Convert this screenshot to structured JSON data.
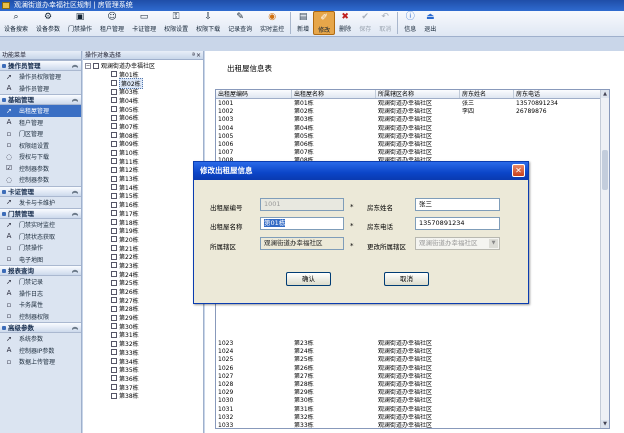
{
  "window": {
    "title": "观澜街道办幸福社区规制 | 房管理系统"
  },
  "toolbar": [
    {
      "label": "设备搜索",
      "icon": "search-device-icon"
    },
    {
      "label": "设备参数",
      "icon": "device-param-icon"
    },
    {
      "label": "门禁操作",
      "icon": "door-control-icon"
    },
    {
      "label": "租户管理",
      "icon": "tenant-icon"
    },
    {
      "label": "卡证管理",
      "icon": "card-icon"
    },
    {
      "label": "权限设置",
      "icon": "permission-icon"
    },
    {
      "label": "权限下载",
      "icon": "download-icon"
    },
    {
      "label": "记录查询",
      "icon": "record-query-icon"
    },
    {
      "label": "实时监控",
      "icon": "monitor-icon"
    },
    {
      "label": "新增",
      "icon": "add-icon"
    },
    {
      "label": "修改",
      "icon": "edit-icon"
    },
    {
      "label": "删除",
      "icon": "delete-icon"
    },
    {
      "label": "保存",
      "icon": "save-icon"
    },
    {
      "label": "取消",
      "icon": "cancel-icon"
    },
    {
      "label": "信息",
      "icon": "info-icon"
    },
    {
      "label": "退出",
      "icon": "exit-icon"
    }
  ],
  "leftpanel": {
    "title": "功能菜单",
    "groups": [
      {
        "title": "操作员管理",
        "items": [
          {
            "label": "操作员权限管理",
            "icon": "cursor"
          },
          {
            "label": "操作员管理",
            "icon": "A"
          }
        ]
      },
      {
        "title": "基础管理",
        "items": [
          {
            "label": "出租屋管理",
            "icon": "cursor"
          },
          {
            "label": "租户管理",
            "icon": "A"
          },
          {
            "label": "门区管理",
            "icon": "square"
          },
          {
            "label": "权限组设置",
            "icon": "square"
          },
          {
            "label": "授权与下载",
            "icon": "circle"
          },
          {
            "label": "控制器参数",
            "icon": "check"
          },
          {
            "label": "控制器参数",
            "icon": "circle"
          }
        ]
      },
      {
        "title": "卡证管理",
        "items": [
          {
            "label": "发卡与卡维护",
            "icon": "cursor"
          }
        ]
      },
      {
        "title": "门禁管理",
        "items": [
          {
            "label": "门禁实时监控",
            "icon": "cursor"
          },
          {
            "label": "门禁状态获取",
            "icon": "A"
          },
          {
            "label": "门禁操作",
            "icon": "square"
          },
          {
            "label": "电子地图",
            "icon": "square"
          }
        ]
      },
      {
        "title": "报表查询",
        "items": [
          {
            "label": "门禁记录",
            "icon": "cursor"
          },
          {
            "label": "操作日志",
            "icon": "A"
          },
          {
            "label": "卡务属性",
            "icon": "square"
          },
          {
            "label": "控制器权限",
            "icon": "square"
          }
        ]
      },
      {
        "title": "高级参数",
        "items": [
          {
            "label": "系统参数",
            "icon": "cursor"
          },
          {
            "label": "控制器IP参数",
            "icon": "A"
          },
          {
            "label": "数据上传管理",
            "icon": "square"
          }
        ]
      }
    ]
  },
  "treepanel": {
    "title": "操作对象选择",
    "root": "观澜街道办幸福社区",
    "nodes": [
      "第01栋",
      "第02栋",
      "第03栋",
      "第04栋",
      "第05栋",
      "第06栋",
      "第07栋",
      "第08栋",
      "第09栋",
      "第10栋",
      "第11栋",
      "第12栋",
      "第13栋",
      "第14栋",
      "第15栋",
      "第16栋",
      "第17栋",
      "第18栋",
      "第19栋",
      "第20栋",
      "第21栋",
      "第22栋",
      "第23栋",
      "第24栋",
      "第25栋",
      "第26栋",
      "第27栋",
      "第28栋",
      "第29栋",
      "第30栋",
      "第31栋",
      "第32栋",
      "第33栋",
      "第34栋",
      "第35栋",
      "第36栋",
      "第37栋",
      "第38栋"
    ]
  },
  "main": {
    "title": "出租屋信息表",
    "columns": [
      "出租屋编码",
      "出租屋名称",
      "所属辖区名称",
      "房东姓名",
      "房东电话"
    ],
    "rows_top": [
      [
        "1001",
        "第01栋",
        "观澜街道办幸福社区",
        "张三",
        "13570891234"
      ],
      [
        "1002",
        "第02栋",
        "观澜街道办幸福社区",
        "李四",
        "26789876"
      ],
      [
        "1003",
        "第03栋",
        "观澜街道办幸福社区",
        "",
        ""
      ],
      [
        "1004",
        "第04栋",
        "观澜街道办幸福社区",
        "",
        ""
      ],
      [
        "1005",
        "第05栋",
        "观澜街道办幸福社区",
        "",
        ""
      ],
      [
        "1006",
        "第06栋",
        "观澜街道办幸福社区",
        "",
        ""
      ],
      [
        "1007",
        "第07栋",
        "观澜街道办幸福社区",
        "",
        ""
      ],
      [
        "1008",
        "第08栋",
        "观澜街道办幸福社区",
        "",
        ""
      ]
    ],
    "rows_bottom": [
      [
        "1023",
        "第23栋",
        "观澜街道办幸福社区",
        "",
        ""
      ],
      [
        "1024",
        "第24栋",
        "观澜街道办幸福社区",
        "",
        ""
      ],
      [
        "1025",
        "第25栋",
        "观澜街道办幸福社区",
        "",
        ""
      ],
      [
        "1026",
        "第26栋",
        "观澜街道办幸福社区",
        "",
        ""
      ],
      [
        "1027",
        "第27栋",
        "观澜街道办幸福社区",
        "",
        ""
      ],
      [
        "1028",
        "第28栋",
        "观澜街道办幸福社区",
        "",
        ""
      ],
      [
        "1029",
        "第29栋",
        "观澜街道办幸福社区",
        "",
        ""
      ],
      [
        "1030",
        "第30栋",
        "观澜街道办幸福社区",
        "",
        ""
      ],
      [
        "1031",
        "第31栋",
        "观澜街道办幸福社区",
        "",
        ""
      ],
      [
        "1032",
        "第32栋",
        "观澜街道办幸福社区",
        "",
        ""
      ],
      [
        "1033",
        "第33栋",
        "观澜街道办幸福社区",
        "",
        ""
      ],
      [
        "1034",
        "第34栋",
        "观澜街道办幸福社区",
        "",
        ""
      ],
      [
        "1035",
        "第35栋",
        "观澜街道办幸福社区",
        "",
        ""
      ]
    ]
  },
  "dialog": {
    "title": "修改出租屋信息",
    "code_label": "出租屋编号",
    "code_value": "1001",
    "name_label": "出租屋名称",
    "name_value": "第01栋",
    "district_label": "所属辖区",
    "district_value": "观澜街道办幸福社区",
    "landlord_label": "房东姓名",
    "landlord_value": "张三",
    "phone_label": "房东电话",
    "phone_value": "13570891234",
    "change_district_label": "更改所属辖区",
    "change_district_value": "观澜街道办幸福社区",
    "required_mark": "*",
    "ok_label": "确认",
    "cancel_label": "取消"
  }
}
